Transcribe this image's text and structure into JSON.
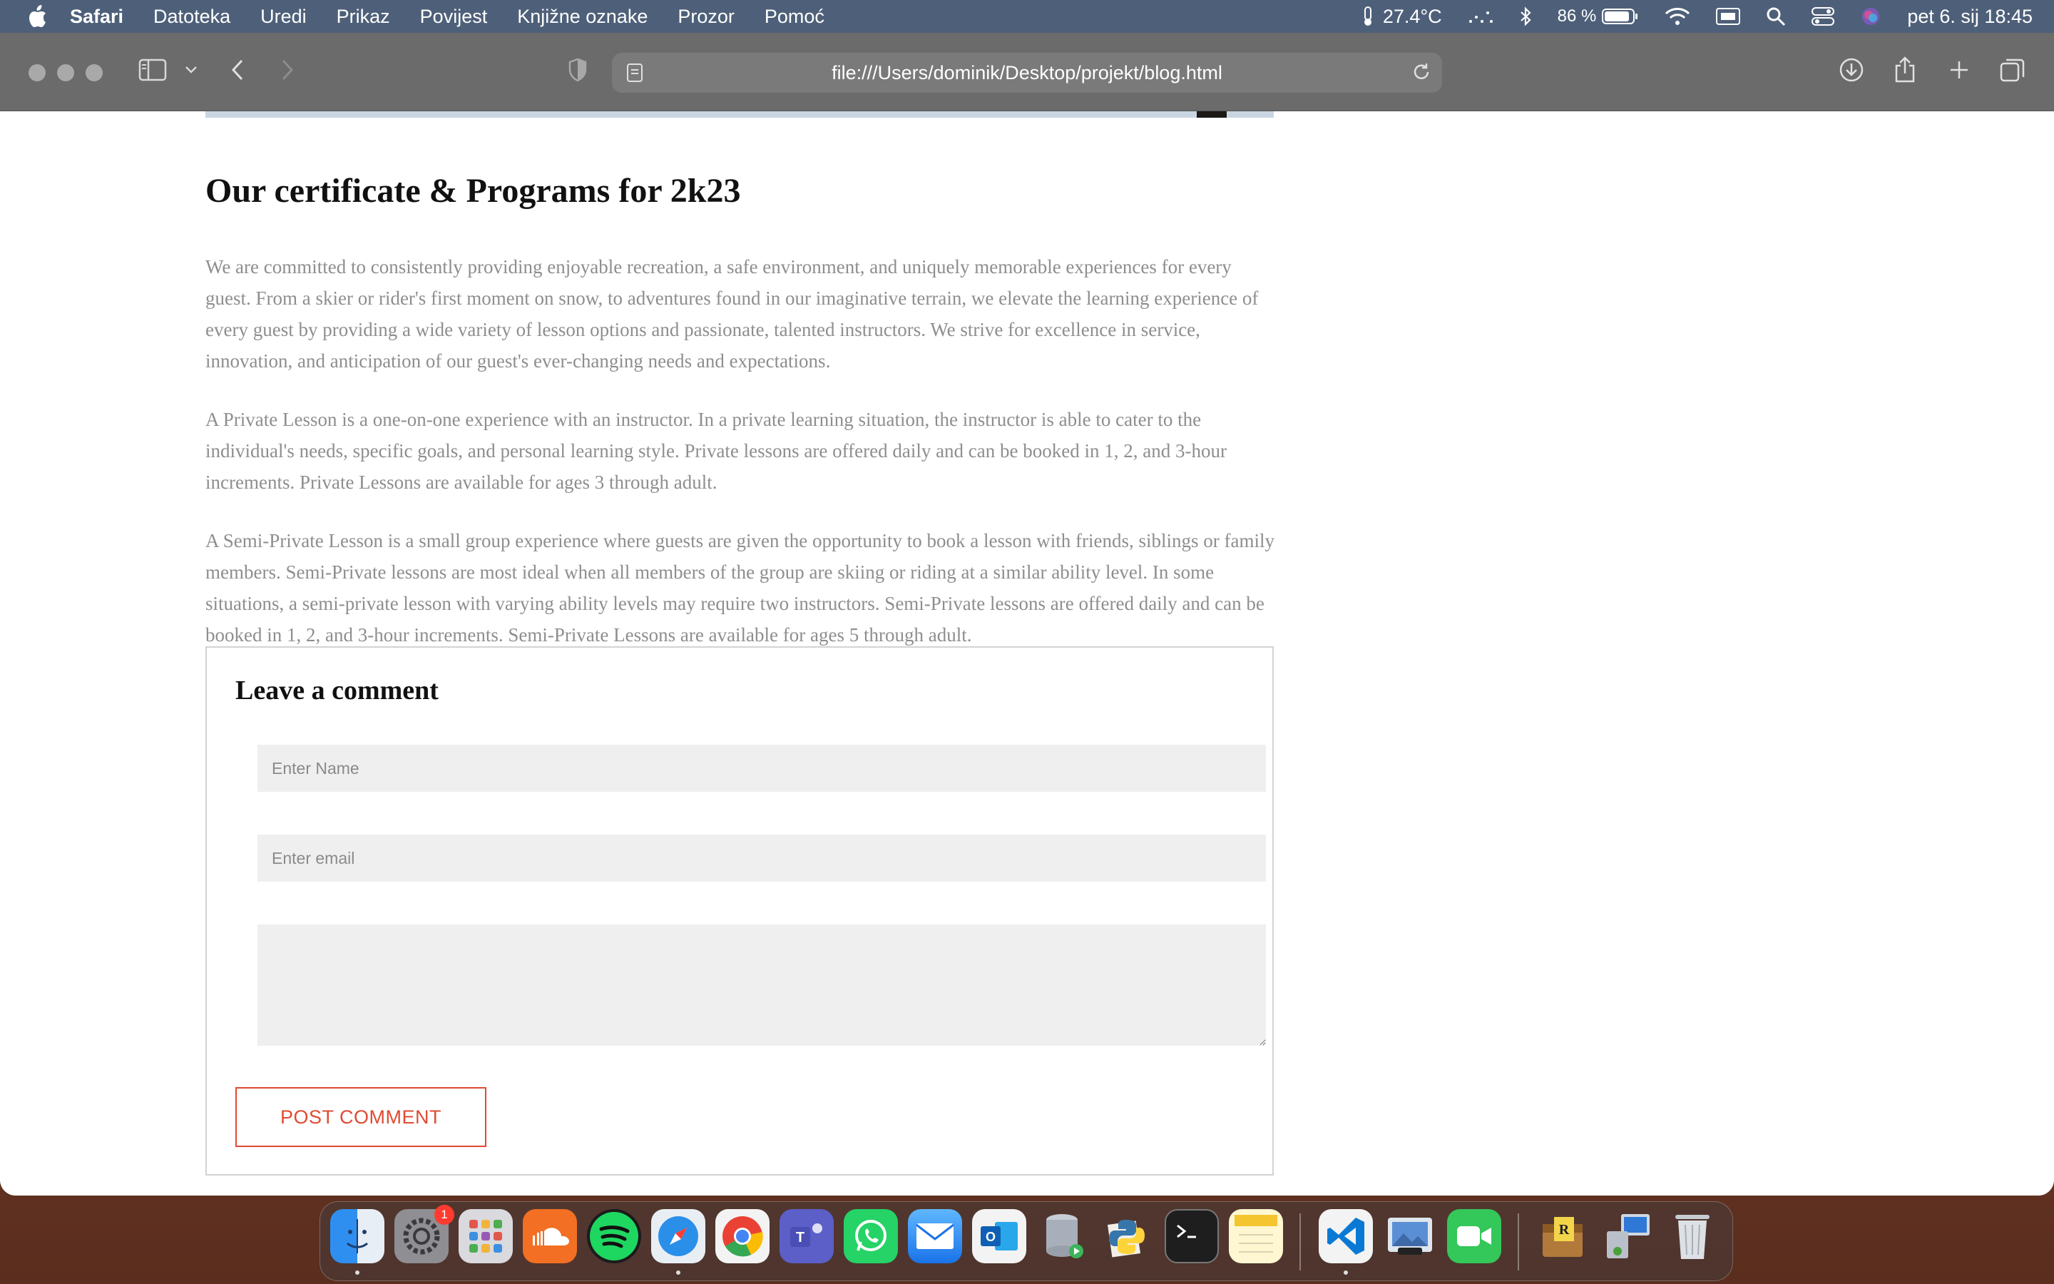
{
  "menubar": {
    "app_name": "Safari",
    "items": [
      "Datoteka",
      "Uredi",
      "Prikaz",
      "Povijest",
      "Knjižne oznake",
      "Prozor",
      "Pomoć"
    ],
    "temperature": "27.4°C",
    "battery_percent": "86 %",
    "datetime": "pet 6. sij  18:45"
  },
  "browser": {
    "url": "file:///Users/dominik/Desktop/projekt/blog.html"
  },
  "page": {
    "title": "Our certificate & Programs for 2k23",
    "paragraphs": [
      "We are committed to consistently providing enjoyable recreation, a safe environment, and uniquely memorable experiences for every guest. From a skier or rider's first moment on snow, to adventures found in our imaginative terrain, we elevate the learning experience of every guest by providing a wide variety of lesson options and passionate, talented instructors. We strive for excellence in service, innovation, and anticipation of our guest's ever-changing needs and expectations.",
      "A Private Lesson is a one-on-one experience with an instructor. In a private learning situation, the instructor is able to cater to the individual's needs, specific goals, and personal learning style. Private lessons are offered daily and can be booked in 1, 2, and 3-hour increments. Private Lessons are available for ages 3 through adult.",
      "A Semi-Private Lesson is a small group experience where guests are given the opportunity to book a lesson with friends, siblings or family members. Semi-Private lessons are most ideal when all members of the group are skiing or riding at a similar ability level. In some situations, a semi-private lesson with varying ability levels may require two instructors. Semi-Private lessons are offered daily and can be booked in 1, 2, and 3-hour increments. Semi-Private Lessons are available for ages 5 through adult."
    ],
    "comment": {
      "heading": "Leave a comment",
      "name_placeholder": "Enter Name",
      "email_placeholder": "Enter email",
      "message_placeholder": "",
      "submit_label": "POST COMMENT"
    }
  },
  "dock": {
    "settings_badge": "1",
    "apps": [
      "finder-icon",
      "system-settings-icon",
      "launchpad-icon",
      "soundcloud-icon",
      "spotify-icon",
      "safari-icon",
      "chrome-icon",
      "teams-icon",
      "whatsapp-icon",
      "mail-icon",
      "outlook-icon",
      "database-icon",
      "python-icon",
      "terminal-icon",
      "notes-icon",
      "vscode-icon",
      "preview-icon",
      "facetime-icon",
      "archive-utility-icon",
      "network-utility-icon",
      "trash-icon"
    ]
  },
  "colors": {
    "menubar": "#4e6079",
    "toolbar": "#6b6b6b",
    "accent_red": "#e04b33",
    "paragraph_text": "#8e8e8e"
  }
}
